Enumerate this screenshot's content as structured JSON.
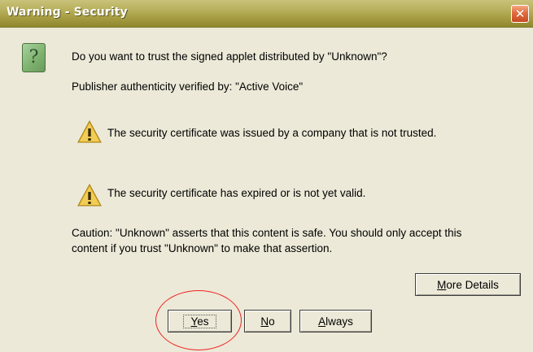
{
  "window": {
    "title": "Warning - Security",
    "close_glyph": "✕"
  },
  "dialog": {
    "question_glyph": "?",
    "question": "Do you want to trust the signed applet distributed by \"Unknown\"?",
    "publisher": "Publisher authenticity verified by: \"Active Voice\"",
    "warnings": [
      "The security certificate was issued by a company that is not trusted.",
      "The security certificate has expired or is not yet valid."
    ],
    "caution_line1": "Caution: \"Unknown\" asserts that this content is safe. You should only accept this",
    "caution_line2": "content if you trust \"Unknown\" to make that assertion."
  },
  "buttons": {
    "more_details": {
      "mnemonic": "M",
      "rest": "ore Details"
    },
    "yes": {
      "mnemonic": "Y",
      "rest": "es"
    },
    "no": {
      "mnemonic": "N",
      "rest": "o"
    },
    "always": {
      "mnemonic": "A",
      "rest": "lways"
    }
  },
  "colors": {
    "titlebar": "#b9b15e",
    "close": "#df6c3f",
    "annotation_circle": "#e22222"
  },
  "icons": [
    "question-icon",
    "warning-icon",
    "close-icon"
  ]
}
